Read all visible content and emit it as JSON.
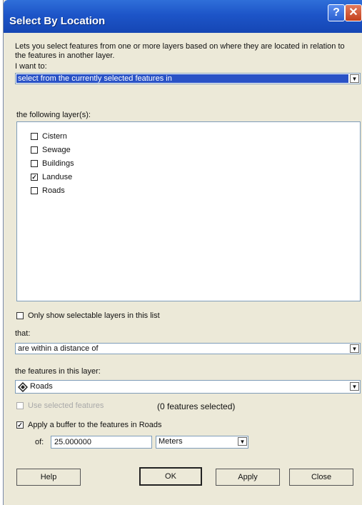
{
  "window": {
    "title": "Select By Location",
    "help_glyph": "?",
    "close_glyph": "✕"
  },
  "description": "Lets you select features from one or more layers based on where they are located in relation to the features in another layer.",
  "i_want_to": {
    "label": "I want to:",
    "value": "select from the currently selected features in"
  },
  "layers": {
    "label": "the following layer(s):",
    "items": [
      {
        "label": "Cistern",
        "checked": false
      },
      {
        "label": "Sewage",
        "checked": false
      },
      {
        "label": "Buildings",
        "checked": false
      },
      {
        "label": "Landuse",
        "checked": true
      },
      {
        "label": "Roads",
        "checked": false
      }
    ]
  },
  "only_selectable": {
    "label": "Only show selectable layers in this list",
    "checked": false
  },
  "that": {
    "label": "that:",
    "value": "are within a distance of"
  },
  "source_layer": {
    "label": "the features in this layer:",
    "value": "Roads",
    "icon": "diamond-layer-icon"
  },
  "use_selected": {
    "label": "Use selected features",
    "count_text": "(0 features selected)",
    "checked": false
  },
  "buffer": {
    "label": "Apply a buffer to the features in Roads",
    "checked": true,
    "of_label": "of:",
    "distance": "25.000000",
    "units": "Meters"
  },
  "buttons": {
    "help": "Help",
    "ok": "OK",
    "apply": "Apply",
    "close": "Close"
  },
  "colors": {
    "titlebar": "#1d55c8",
    "selection": "#2952c6",
    "dialog_bg": "#ece9d8"
  }
}
